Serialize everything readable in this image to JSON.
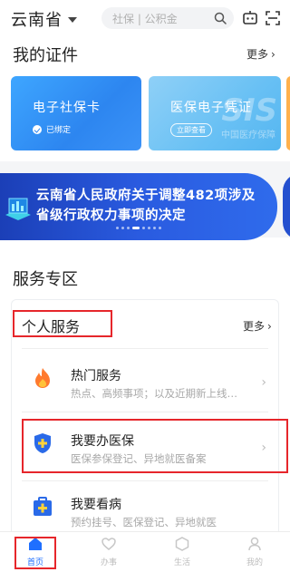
{
  "header": {
    "province": "云南省",
    "search_placeholder": "社保 | 公积金"
  },
  "certificates": {
    "title": "我的证件",
    "more": "更多",
    "cards": [
      {
        "name": "电子社保卡",
        "status": "已绑定"
      },
      {
        "name": "医保电子凭证",
        "action": "立即查看",
        "watermark": "SIS",
        "watermark_sub": "中国医疗保障"
      }
    ]
  },
  "banner": {
    "text": "云南省人民政府关于调整482项涉及省级行政权力事项的决定"
  },
  "services": {
    "zone_title": "服务专区",
    "personal_title": "个人服务",
    "more": "更多",
    "items": [
      {
        "title": "热门服务",
        "desc": "热点、高频事项；以及近期新上线…",
        "icon": "flame-icon"
      },
      {
        "title": "我要办医保",
        "desc": "医保参保登记、异地就医备案",
        "icon": "shield-plus-icon"
      },
      {
        "title": "我要看病",
        "desc": "预约挂号、医保登记、异地就医",
        "icon": "medical-kit-icon"
      }
    ]
  },
  "tabbar": {
    "tabs": [
      {
        "label": "首页",
        "active": true
      },
      {
        "label": "办事"
      },
      {
        "label": "生活"
      },
      {
        "label": "我的"
      }
    ]
  },
  "colors": {
    "accent": "#1f6fff",
    "highlight": "#e6262b",
    "card_blue": "#2d86f0",
    "card_light_blue": "#68c0f4",
    "banner_blue": "#2a5be0"
  }
}
